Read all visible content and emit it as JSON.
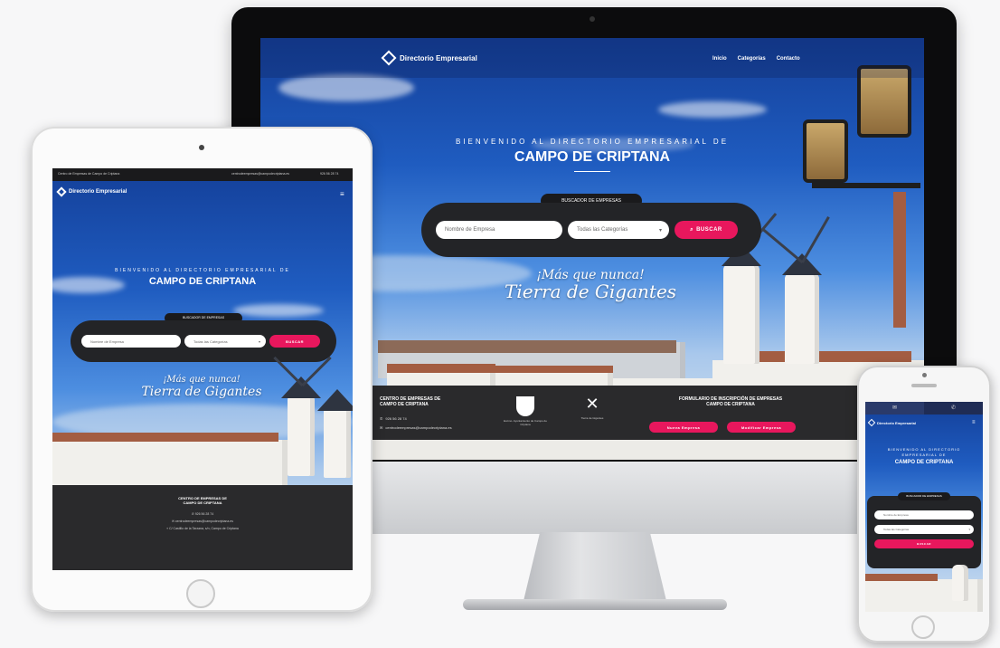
{
  "brand": {
    "name": "Directorio Empresarial",
    "tagline": "CAMPO DE CRIPTANA"
  },
  "nav": {
    "items": [
      "Inicio",
      "Categorías",
      "Contacto"
    ],
    "accent": "#e8175d"
  },
  "hero": {
    "welcome": "BIENVENIDO AL DIRECTORIO EMPRESARIAL DE",
    "title": "CAMPO DE CRIPTANA",
    "slogan_line1": "¡Más que nunca!",
    "slogan_line2": "Tierra de Gigantes"
  },
  "search": {
    "tag": "BUSCADOR DE EMPRESAS",
    "name_placeholder": "Nombre de Empresa",
    "category_value": "Todas las Categorías",
    "button": "BUSCAR"
  },
  "footer": {
    "center_title": "CENTRO DE EMPRESAS DE\nCAMPO DE CRIPTANA",
    "phone": "926 56 28 74",
    "email": "centrodeempresas@campodecriptana.es",
    "address": "C/ Castillo de la Tarzana, s/n, Campo de Criptana",
    "logo1_caption": "Excmo. Ayuntamiento de Campo de Criptana",
    "logo2_caption": "Tierra de Gigantes",
    "form_title": "FORMULARIO DE INSCRIPCIÓN DE EMPRESAS\nCAMPO DE CRIPTANA",
    "form_btn1": "Nueva Empresa",
    "form_btn2": "Modificar Empresa"
  },
  "topbar": {
    "left": "Centro de Empresas de Campo de Criptana",
    "email": "centrodeempresas@campodecriptana.es",
    "phone": "926 56 28 74"
  },
  "icons": [
    "phone-icon",
    "mail-icon",
    "location-icon",
    "menu-icon",
    "search-icon"
  ]
}
